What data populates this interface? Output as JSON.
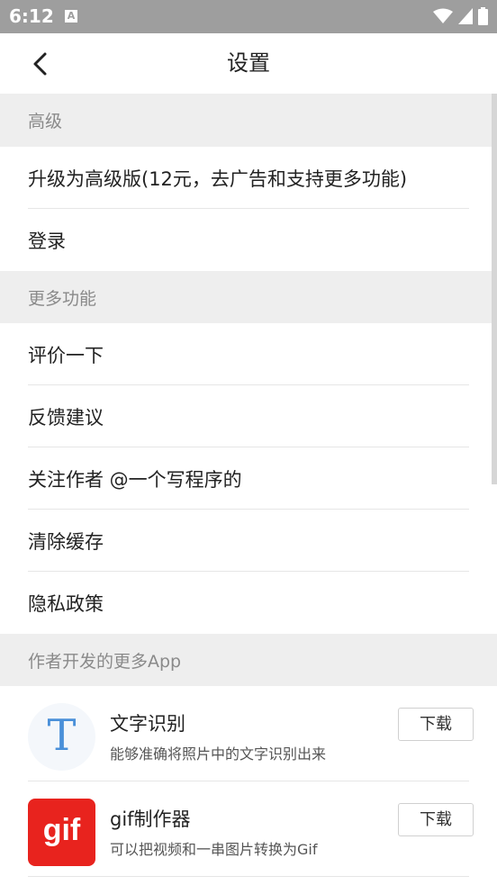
{
  "status_bar": {
    "time": "6:12",
    "notification_icon": "A",
    "icons": [
      "wifi-icon",
      "cellular-signal-icon",
      "battery-icon"
    ]
  },
  "header": {
    "back_icon": "chevron-left-icon",
    "title": "设置"
  },
  "sections": {
    "advanced": {
      "title": "高级",
      "items": {
        "upgrade": "升级为高级版(12元，去广告和支持更多功能)",
        "login": "登录"
      }
    },
    "more": {
      "title": "更多功能",
      "items": {
        "rate": "评价一下",
        "feedback": "反馈建议",
        "follow": "关注作者 @一个写程序的",
        "clear_cache": "清除缓存",
        "privacy": "隐私政策"
      }
    },
    "apps": {
      "title": "作者开发的更多App",
      "list": [
        {
          "name": "文字识别",
          "desc": "能够准确将照片中的文字识别出来",
          "button": "下载",
          "icon_text": "T"
        },
        {
          "name": "gif制作器",
          "desc": "可以把视频和一串图片转换为Gif",
          "button": "下载",
          "icon_text": "gif"
        }
      ]
    }
  },
  "colors": {
    "status_bar": "#9e9e9e",
    "section_bg": "#eeeeee",
    "gif_icon": "#e8231e",
    "ocr_icon": "#4a90d9"
  }
}
